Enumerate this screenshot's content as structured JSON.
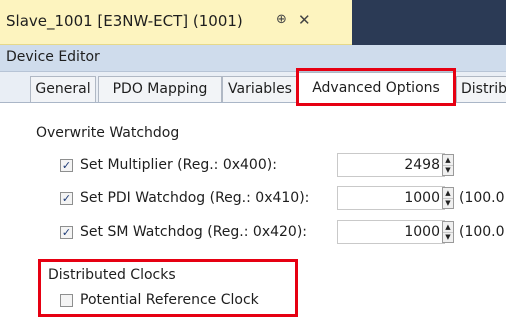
{
  "document_tab": {
    "title": "Slave_1001 [E3NW-ECT] (1001)",
    "pin_icon": "⊕",
    "close_icon": "✕"
  },
  "editor": {
    "title": "Device Editor"
  },
  "tabs": [
    {
      "label": "General"
    },
    {
      "label": "PDO Mapping"
    },
    {
      "label": "Variables"
    },
    {
      "label": "Advanced Options",
      "active": true
    },
    {
      "label": "Distrib"
    }
  ],
  "watchdog": {
    "section_label": "Overwrite Watchdog",
    "rows": [
      {
        "label": "Set Multiplier (Reg.: 0x400):",
        "checked": true,
        "value": "2498",
        "extra": ""
      },
      {
        "label": "Set PDI Watchdog (Reg.: 0x410):",
        "checked": true,
        "value": "1000",
        "extra": "(100.0"
      },
      {
        "label": "Set SM Watchdog (Reg.: 0x420):",
        "checked": true,
        "value": "1000",
        "extra": "(100.0"
      }
    ]
  },
  "distributed_clocks": {
    "section_label": "Distributed Clocks",
    "potential_reference_clock": {
      "label": "Potential Reference Clock",
      "checked": false
    }
  },
  "highlight_color": "#e60012",
  "check_mark": "✓"
}
